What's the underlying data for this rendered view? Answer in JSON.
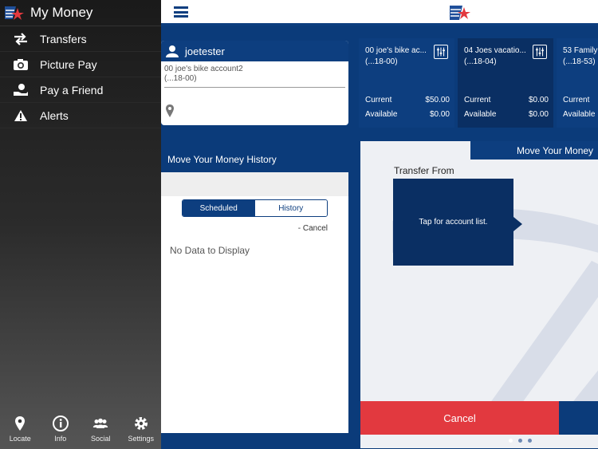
{
  "sidebar": {
    "title": "My Money",
    "items": [
      {
        "label": "Transfers",
        "icon": "transfer-icon"
      },
      {
        "label": "Picture Pay",
        "icon": "camera-icon"
      },
      {
        "label": "Pay a Friend",
        "icon": "hand-icon"
      },
      {
        "label": "Alerts",
        "icon": "warning-icon"
      }
    ],
    "footer": [
      {
        "label": "Locate",
        "icon": "location-pin-icon"
      },
      {
        "label": "Info",
        "icon": "info-icon"
      },
      {
        "label": "Social",
        "icon": "people-icon"
      },
      {
        "label": "Settings",
        "icon": "gear-icon"
      }
    ]
  },
  "user": {
    "name": "joetester",
    "account_name": "00 joe's bike account2",
    "account_num": "(...18-00)"
  },
  "history": {
    "title": "Move Your Money History",
    "tabs": [
      "Scheduled",
      "History"
    ],
    "cancel": "- Cancel",
    "empty": "No Data to Display"
  },
  "accounts": [
    {
      "name": "00 joe's bike ac...",
      "num": "(...18-00)",
      "current_label": "Current",
      "current": "$50.00",
      "available_label": "Available",
      "available": "$0.00"
    },
    {
      "name": "04 Joes vacatio...",
      "num": "(...18-04)",
      "current_label": "Current",
      "current": "$0.00",
      "available_label": "Available",
      "available": "$0.00"
    },
    {
      "name": "53 Family",
      "num": "(...18-53)",
      "current_label": "Current",
      "current": "",
      "available_label": "Available",
      "available": ""
    }
  ],
  "transfer": {
    "tab_title": "Move Your Money",
    "from_label": "Transfer From",
    "box_text": "Tap for account list.",
    "cancel": "Cancel"
  },
  "colors": {
    "brand": "#0d3e7f",
    "danger": "#e2393f"
  }
}
